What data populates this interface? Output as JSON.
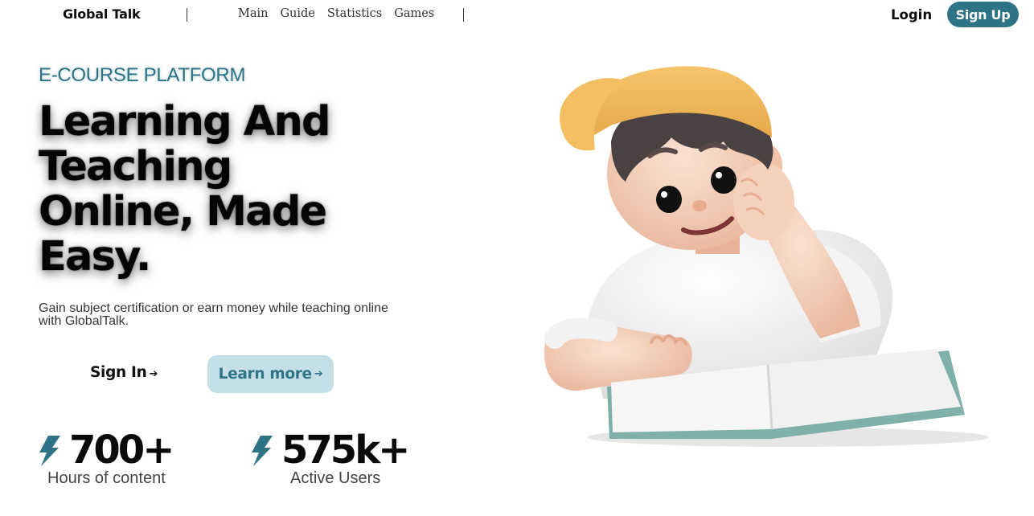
{
  "nav": {
    "brand": "Global Talk",
    "menu": [
      "Main",
      "Guide",
      "Statistics",
      "Games"
    ],
    "login": "Login",
    "signup": "Sign Up"
  },
  "hero": {
    "eyebrow": "E-COURSE PLATFORM",
    "headline_lines": [
      "Learning And",
      "Teaching",
      "Online, Made",
      "Easy."
    ],
    "subtitle": "Gain subject certification or earn money while teaching online with GlobalTalk.",
    "signin": "Sign In",
    "learn_more": "Learn more",
    "arrow": "➔"
  },
  "stats": [
    {
      "value": "700+",
      "label": "Hours of content",
      "icon": "lightning-icon"
    },
    {
      "value": "575k+",
      "label": "Active Users",
      "icon": "lightning-icon"
    }
  ],
  "illustration": {
    "icon": "boy-reading-book-illustration"
  },
  "colors": {
    "accent": "#2e7386",
    "accent_light": "#c5dfe6",
    "text": "#050505"
  }
}
